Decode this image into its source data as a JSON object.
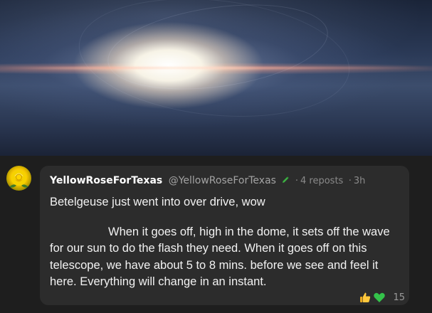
{
  "post": {
    "author_name": "YellowRoseForTexas",
    "handle": "@YellowRoseForTexas",
    "reposts": "4 reposts",
    "separator": "·",
    "time": "3h",
    "line1": "Betelgeuse just went into over drive, wow",
    "line2": "When it goes off, high in the dome, it sets off the wave for our sun to do the flash they need. When it goes off on this telescope, we have about 5 to 8 mins. before we see and feel it here. Everything will change in an instant.",
    "reaction_count": "15",
    "reactions": [
      "thumbs-up-icon",
      "green-heart-icon"
    ]
  },
  "colors": {
    "background": "#1e1e1e",
    "card": "#2c2c2c",
    "text": "#f2f2f2",
    "muted": "#a3a3a3",
    "verified_pen": "#3cb043"
  }
}
